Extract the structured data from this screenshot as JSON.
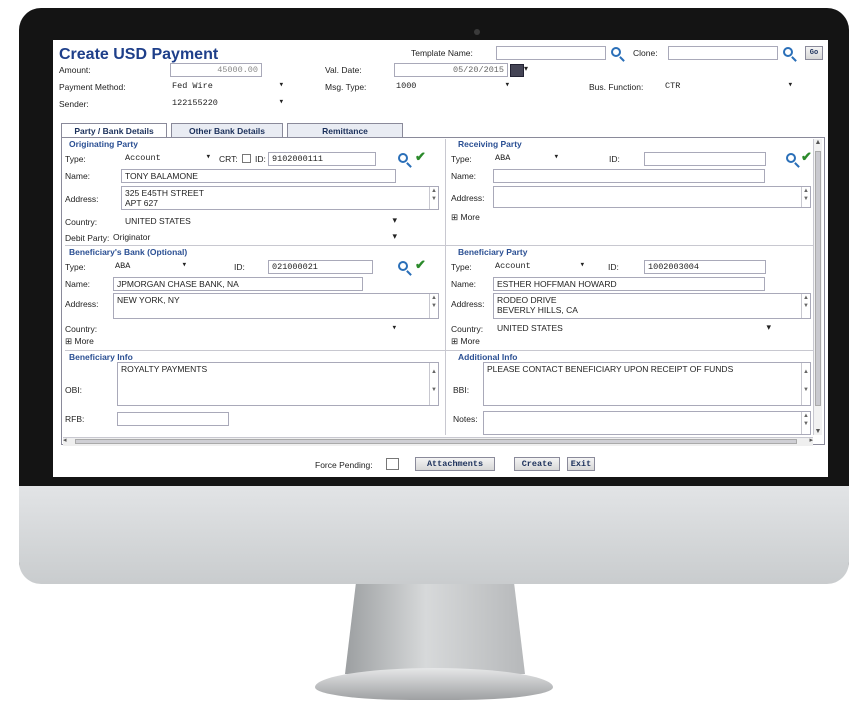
{
  "form": {
    "title": "Create USD Payment",
    "template_name_label": "Template Name:",
    "template_name_value": "",
    "clone_label": "Clone:",
    "clone_value": "",
    "go_label": "Go",
    "amount_label": "Amount:",
    "amount_value": "45000.00",
    "val_date_label": "Val. Date:",
    "val_date_value": "05/20/2015",
    "payment_method_label": "Payment Method:",
    "payment_method_value": "Fed Wire",
    "msg_type_label": "Msg. Type:",
    "msg_type_value": "1000",
    "bus_function_label": "Bus. Function:",
    "bus_function_value": "CTR",
    "sender_label": "Sender:",
    "sender_value": "122155220"
  },
  "tabs": [
    {
      "label": "Party / Bank Details"
    },
    {
      "label": "Other Bank Details"
    },
    {
      "label": "Remittance"
    }
  ],
  "originating": {
    "header": "Originating Party",
    "type_label": "Type:",
    "type_value": "Account",
    "crt_label": "CRT:",
    "id_label": "ID:",
    "id_value": "9102000111",
    "name_label": "Name:",
    "name_value": "TONY BALAMONE",
    "address_label": "Address:",
    "address_line1": "325 E45TH STREET",
    "address_line2": "APT 627",
    "country_label": "Country:",
    "country_value": "UNITED STATES",
    "debit_party_label": "Debit Party:",
    "debit_party_value": "Originator"
  },
  "receiving": {
    "header": "Receiving Party",
    "type_label": "Type:",
    "type_value": "ABA",
    "id_label": "ID:",
    "id_value": "",
    "name_label": "Name:",
    "address_label": "Address:",
    "more_label": "⊞ More"
  },
  "beneficiary_bank": {
    "header": "Beneficiary's Bank (Optional)",
    "type_label": "Type:",
    "type_value": "ABA",
    "id_label": "ID:",
    "id_value": "021000021",
    "name_label": "Name:",
    "name_value": "JPMORGAN CHASE BANK, NA",
    "address_label": "Address:",
    "address_value": "NEW YORK, NY",
    "country_label": "Country:",
    "more_label": "⊞ More"
  },
  "beneficiary_party": {
    "header": "Beneficiary Party",
    "type_label": "Type:",
    "type_value": "Account",
    "id_label": "ID:",
    "id_value": "1002003004",
    "name_label": "Name:",
    "name_value": "ESTHER HOFFMAN HOWARD",
    "address_label": "Address:",
    "address_line1": "RODEO DRIVE",
    "address_line2": "BEVERLY HILLS, CA",
    "country_label": "Country:",
    "country_value": "UNITED STATES",
    "more_label": "⊞ More"
  },
  "beneficiary_info": {
    "header": "Beneficiary Info",
    "obi_label": "OBI:",
    "obi_value": "ROYALTY PAYMENTS",
    "rfb_label": "RFB:"
  },
  "additional_info": {
    "header": "Additional Info",
    "bbi_label": "BBI:",
    "bbi_value": "PLEASE CONTACT BENEFICIARY UPON RECEIPT OF FUNDS",
    "notes_label": "Notes:"
  },
  "footer": {
    "force_pending_label": "Force Pending:",
    "attachments_label": "Attachments",
    "create_label": "Create",
    "exit_label": "Exit"
  },
  "colors": {
    "title": "#1e3f8a",
    "section_header": "#2a4f93",
    "accept_check": "#2b8a2b",
    "monitor_bezel": "#141414"
  }
}
